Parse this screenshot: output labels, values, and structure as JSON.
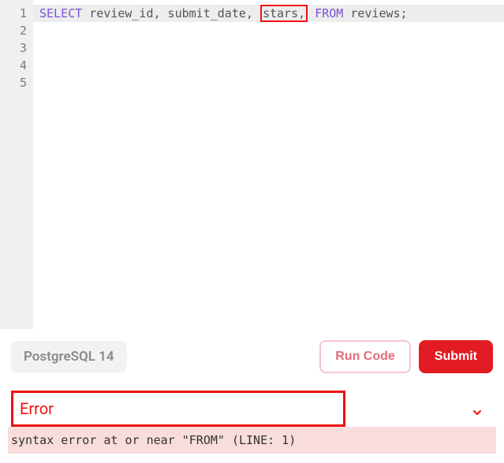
{
  "editor": {
    "line_numbers": [
      1,
      2,
      3,
      4,
      5
    ],
    "code_tokens": {
      "select": "SELECT",
      "cols_before_highlight": " review_id, submit_date, ",
      "highlighted": "stars,",
      "space_after": " ",
      "from": "FROM",
      "rest": " reviews;"
    }
  },
  "toolbar": {
    "db_label": "PostgreSQL 14",
    "run_label": "Run Code",
    "submit_label": "Submit"
  },
  "error": {
    "title": "Error",
    "message": "syntax error at or near \"FROM\" (LINE: 1)"
  }
}
